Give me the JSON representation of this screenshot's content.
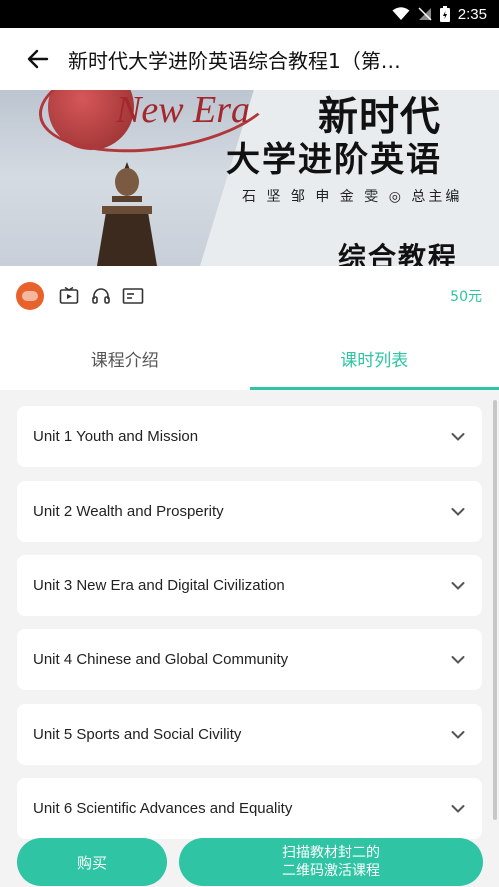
{
  "status_bar": {
    "time": "2:35",
    "icons": [
      "wifi-icon",
      "signal-icon",
      "battery-icon"
    ]
  },
  "header": {
    "title": "新时代大学进阶英语综合教程1（第…",
    "back_icon": "back-arrow-icon"
  },
  "cover": {
    "logo_text": "New Era",
    "title_line1": "新时代",
    "title_line2": "大学进阶英语",
    "authors": "石 坚  邹 申  金 雯 ◎ 总主编",
    "subtitle": "综合教程"
  },
  "info": {
    "features": [
      "video-icon",
      "headphones-icon",
      "document-icon"
    ],
    "price": "50元"
  },
  "tabs": [
    {
      "label": "课程介绍",
      "active": false
    },
    {
      "label": "课时列表",
      "active": true
    }
  ],
  "units": [
    {
      "label": "Unit 1 Youth and Mission"
    },
    {
      "label": "Unit 2 Wealth and Prosperity"
    },
    {
      "label": "Unit 3 New Era and Digital Civilization"
    },
    {
      "label": "Unit 4 Chinese and Global Community"
    },
    {
      "label": "Unit 5 Sports and Social Civility"
    },
    {
      "label": "Unit 6 Scientific Advances and Equality"
    }
  ],
  "actions": {
    "buy_label": "购买",
    "scan_line1": "扫描教材封二的",
    "scan_line2": "二维码激活课程"
  },
  "colors": {
    "accent": "#2ec4a4",
    "publisher": "#e8632b"
  }
}
